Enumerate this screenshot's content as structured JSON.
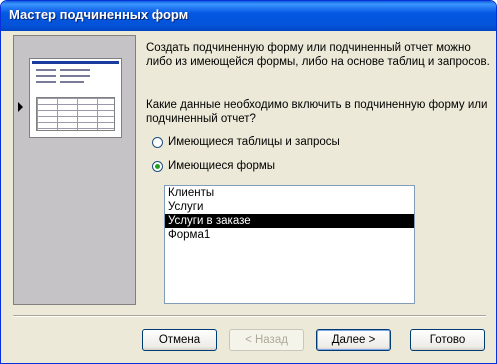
{
  "window": {
    "title": "Мастер подчиненных форм"
  },
  "intro": {
    "line1": "Создать подчиненную форму или подчиненный отчет можно",
    "line2": "либо из имеющейся формы, либо на основе таблиц и запросов."
  },
  "question": {
    "line1": "Какие данные необходимо включить в подчиненную форму или",
    "line2": "подчиненный отчет?"
  },
  "options": [
    {
      "label": "Имеющиеся таблицы и запросы",
      "selected": false
    },
    {
      "label": "Имеющиеся формы",
      "selected": true
    }
  ],
  "forms_list": {
    "items": [
      "Клиенты",
      "Услуги",
      "Услуги в заказе",
      "Форма1"
    ],
    "selected": "Услуги в заказе"
  },
  "buttons": {
    "cancel": "Отмена",
    "back": "< Назад",
    "next": "Далее >",
    "finish": "Готово"
  },
  "colors": {
    "titlebar": "#0054e3",
    "selection": "#000000",
    "radio_dot": "#21a121"
  },
  "icons": {
    "preview": "form-preview-icon",
    "pointer": "pointer-arrow-icon"
  }
}
